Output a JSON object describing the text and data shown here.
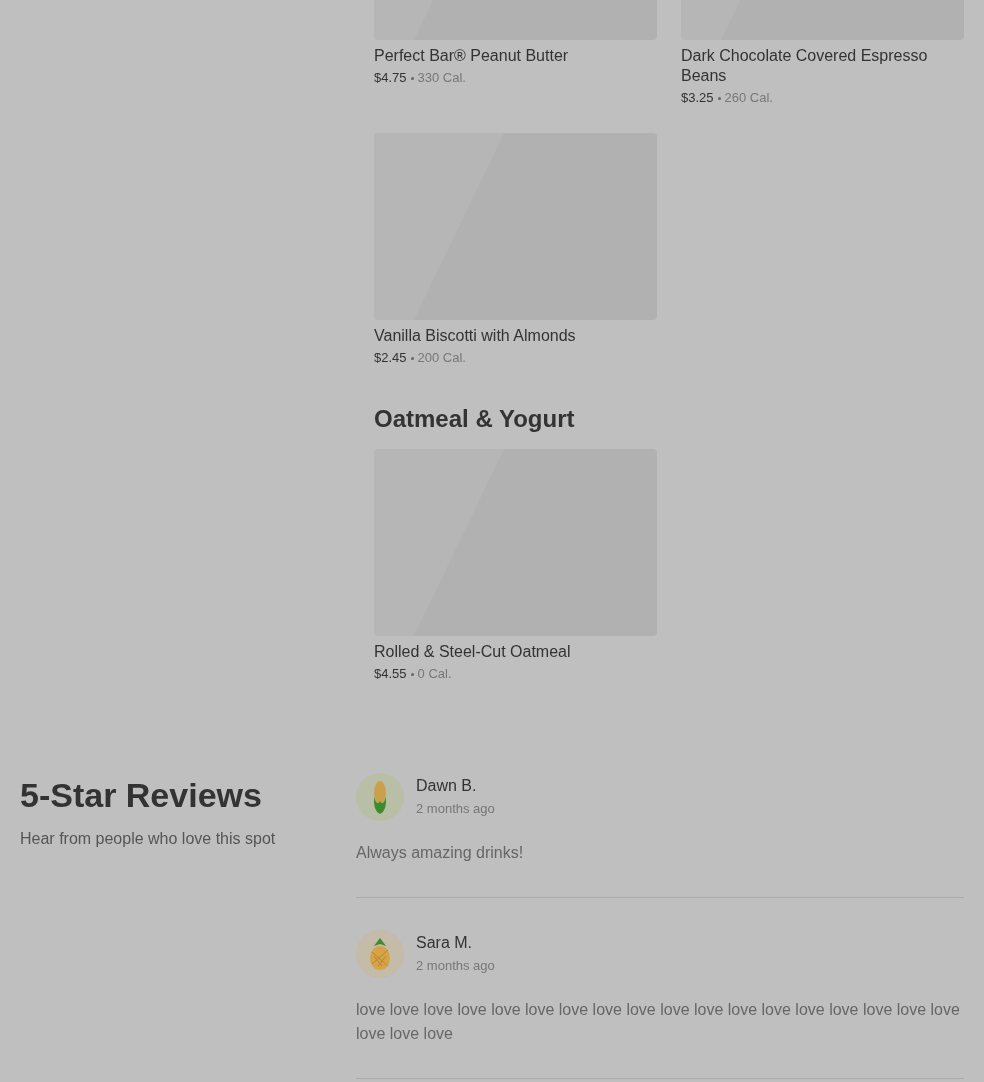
{
  "menu_sections": [
    {
      "items": [
        {
          "name": "Perfect Bar® Peanut Butter",
          "price": "$4.75",
          "calories": "330 Cal."
        },
        {
          "name": "Dark Chocolate Covered Espresso Beans",
          "price": "$3.25",
          "calories": "260 Cal."
        },
        {
          "name": "Vanilla Biscotti with Almonds",
          "price": "$2.45",
          "calories": "200 Cal."
        }
      ]
    },
    {
      "title": "Oatmeal & Yogurt",
      "items": [
        {
          "name": "Rolled & Steel-Cut Oatmeal",
          "price": "$4.55",
          "calories": "0 Cal."
        }
      ]
    }
  ],
  "reviews_section": {
    "title": "5-Star Reviews",
    "subtitle": "Hear from people who love this spot",
    "reviews": [
      {
        "name": "Dawn B.",
        "time": "2 months ago",
        "text": "Always amazing drinks!",
        "avatar": {
          "kind": "corn",
          "color": "#b9bea6"
        }
      },
      {
        "name": "Sara M.",
        "time": "2 months ago",
        "text": "love love love love love love love love love love love love love love love love love love love love love",
        "avatar": {
          "kind": "pineapple",
          "color": "#c4bba8"
        }
      }
    ]
  }
}
